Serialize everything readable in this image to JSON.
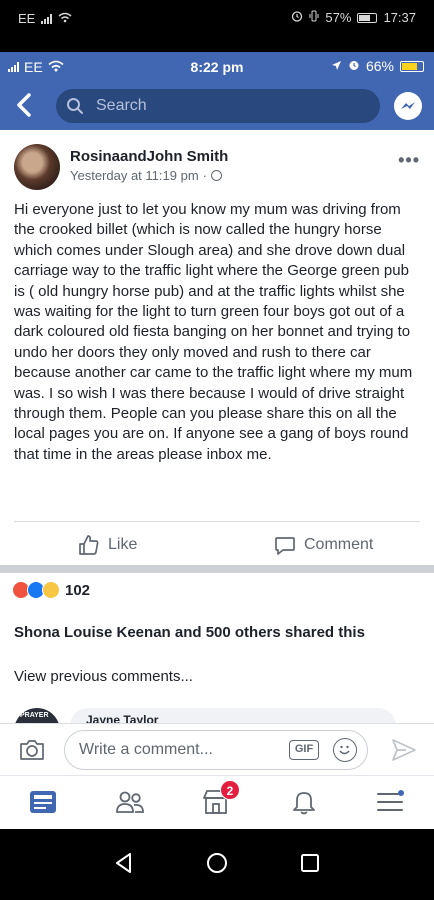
{
  "outer_status": {
    "carrier": "EE",
    "battery": "57%",
    "time": "17:37"
  },
  "ios_status": {
    "carrier": "EE",
    "time": "8:22 pm",
    "battery": "66%"
  },
  "top_bar": {
    "search_placeholder": "Search"
  },
  "post": {
    "author": "RosinaandJohn Smith",
    "timestamp": "Yesterday at 11:19 pm",
    "separator": "·",
    "text": "Hi everyone just to let you know my mum was driving from the crooked billet (which is now called the hungry horse which comes under Slough area) and she drove down dual carriage way to the traffic light where the George green pub is ( old hungry horse pub)  and at the traffic lights whilst she was waiting for the light to turn green four boys got out of a dark coloured old fiesta banging on her bonnet and trying to undo her doors they only moved and rush to there car because another car came to the traffic light where my mum was. I so wish I was there because I would of drive straight through them. People can you please share this on all the local pages you are on. If anyone see a gang of boys round that time in the areas please inbox me.",
    "like_label": "Like",
    "comment_label": "Comment",
    "reaction_count": "102",
    "shared_text": "Shona Louise Keenan and 500 others shared this",
    "view_previous": "View previous comments...",
    "peek_avatar_text": "PRAYER",
    "peek_commenter": "Jayne Taylor"
  },
  "composer": {
    "placeholder": "Write a comment...",
    "gif_label": "GIF"
  },
  "tabbar": {
    "marketplace_badge": "2"
  },
  "colors": {
    "brand": "#4267b2",
    "search_bg": "#29487d",
    "badge": "#e41e3f"
  }
}
